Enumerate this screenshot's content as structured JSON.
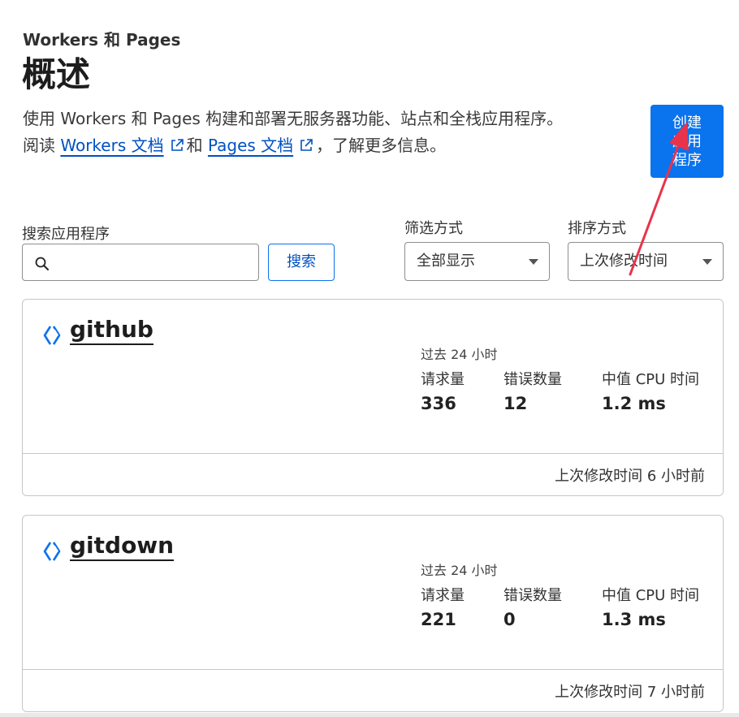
{
  "header": {
    "eyebrow": "Workers 和 Pages",
    "title": "概述"
  },
  "intro": {
    "line1": "使用 Workers 和 Pages 构建和部署无服务器功能、站点和全栈应用程序。",
    "line2_prefix": "阅读 ",
    "workers_docs_link": "Workers 文档",
    "line2_and": "和 ",
    "pages_docs_link": "Pages 文档",
    "line2_suffix": "，了解更多信息。"
  },
  "create_button": {
    "label": "创建应用程序"
  },
  "search": {
    "label": "搜索应用程序",
    "value": "",
    "placeholder": "",
    "button_label": "搜索"
  },
  "filter": {
    "label": "筛选方式",
    "selected": "全部显示"
  },
  "sort": {
    "label": "排序方式",
    "selected": "上次修改时间"
  },
  "apps": [
    {
      "name": "github",
      "period": "过去 24 小时",
      "requests_label": "请求量",
      "requests": "336",
      "errors_label": "错误数量",
      "errors": "12",
      "cpu_label": "中值 CPU 时间",
      "cpu": "1.2 ms",
      "modified": "上次修改时间 6 小时前"
    },
    {
      "name": "gitdown",
      "period": "过去 24 小时",
      "requests_label": "请求量",
      "requests": "221",
      "errors_label": "错误数量",
      "errors": "0",
      "cpu_label": "中值 CPU 时间",
      "cpu": "1.3 ms",
      "modified": "上次修改时间 7 小时前"
    }
  ],
  "colors": {
    "accent": "#0a73ee",
    "link": "#0051c3",
    "annotation_arrow": "#e8334a"
  },
  "icons": {
    "search": "search-icon",
    "external_link": "external-link-icon",
    "worker": "worker-icon",
    "dropdown": "chevron-down-icon"
  }
}
